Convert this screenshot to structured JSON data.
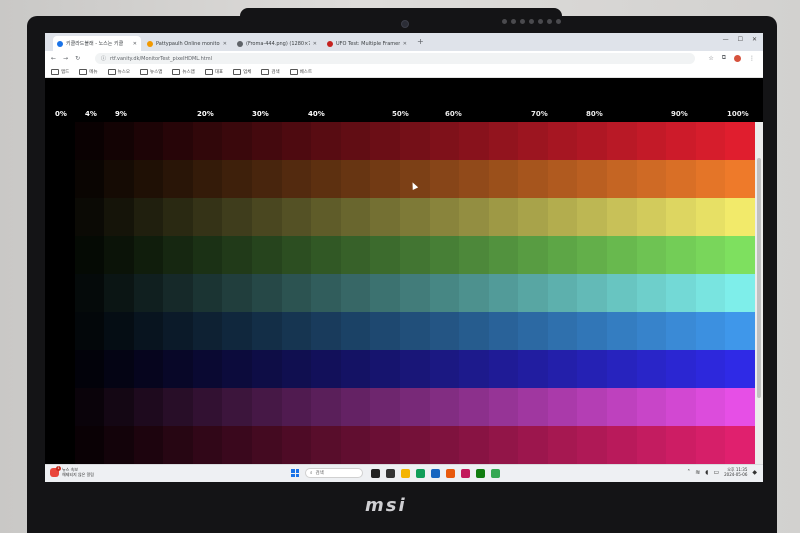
{
  "browser": {
    "tabs": [
      {
        "label": "키클라드블래 - 노스는 키클",
        "fav_color": "#1a73e8",
        "active": true
      },
      {
        "label": "Pattypaulh Online monitor t",
        "fav_color": "#f29900",
        "active": false
      },
      {
        "label": "(Froma-444.png) (1280×720)",
        "fav_color": "#5f6368",
        "active": false
      },
      {
        "label": "UFO Test: Multiple Framerates",
        "fav_color": "#c5221f",
        "active": false
      }
    ],
    "new_tab_symbol": "+",
    "address": "rtf.vanity.dk/MonitorTest_pixelHDML.html",
    "bookmarks": [
      "앱드",
      "메뉴",
      "뉴스오",
      "뉴스앱",
      "뉴스앱",
      "대표",
      "업체",
      "검색",
      "베스트"
    ]
  },
  "test_page": {
    "percent_labels": [
      "0%",
      "4%",
      "9%",
      "20%",
      "30%",
      "40%",
      "50%",
      "60%",
      "70%",
      "80%",
      "90%",
      "100%"
    ],
    "bands": [
      {
        "name": "red",
        "color": "#e01e2e"
      },
      {
        "name": "orange",
        "color": "#ee7a2a"
      },
      {
        "name": "yellow",
        "color": "#f2ea6a"
      },
      {
        "name": "green",
        "color": "#7ee05f"
      },
      {
        "name": "teal",
        "color": "#7eeeea"
      },
      {
        "name": "azure",
        "color": "#3f97ea"
      },
      {
        "name": "blue",
        "color": "#2f2ae6"
      },
      {
        "name": "magenta",
        "color": "#e64fe6"
      },
      {
        "name": "pink",
        "color": "#e0206e"
      }
    ],
    "steps": 24
  },
  "taskbar": {
    "weather_line1": "뉴스 속보",
    "weather_line2": "해제되지 않은 알림",
    "notification_count": "1",
    "search_placeholder": "검색",
    "time": "오후 11:35",
    "date": "2024-05-06",
    "app_colors": [
      "#222222",
      "#333333",
      "#f4b400",
      "#0f9d58",
      "#1565c0",
      "#e8590c",
      "#c2185b",
      "#107c10",
      "#34a853"
    ]
  }
}
